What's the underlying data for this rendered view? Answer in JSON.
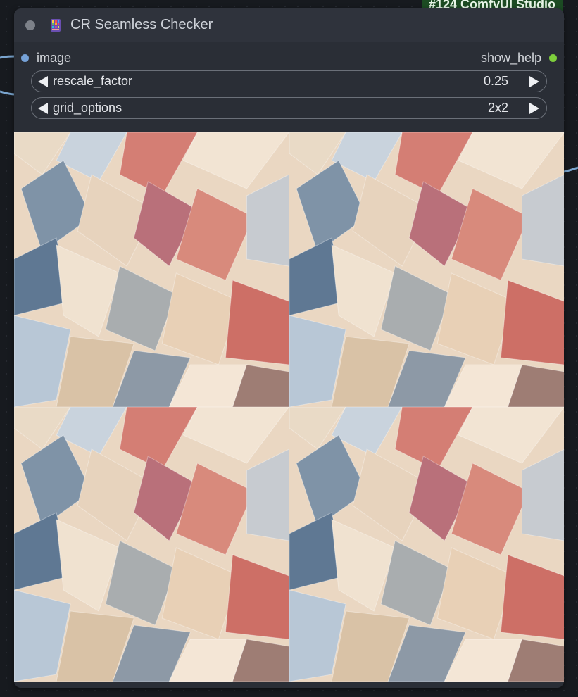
{
  "badge": {
    "text": "#124 ComfyUI Studio"
  },
  "node": {
    "title": "CR Seamless Checker",
    "icon": "color-grid-icon",
    "inputs": [
      {
        "name": "image"
      }
    ],
    "outputs": [
      {
        "name": "show_help"
      }
    ],
    "widgets": [
      {
        "name": "rescale_factor",
        "value": "0.25"
      },
      {
        "name": "grid_options",
        "value": "2x2"
      }
    ]
  },
  "colors": {
    "input_slot": "#76a2d8",
    "output_slot": "#7ecf3c",
    "badge_bg": "#1c4b23",
    "node_bg": "#2a2e36"
  }
}
